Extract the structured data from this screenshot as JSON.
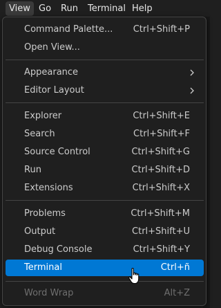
{
  "menubar": {
    "items": [
      "View",
      "Go",
      "Run",
      "Terminal",
      "Help"
    ]
  },
  "menu": {
    "command_palette": {
      "label": "Command Palette...",
      "shortcut": "Ctrl+Shift+P"
    },
    "open_view": {
      "label": "Open View..."
    },
    "appearance": {
      "label": "Appearance",
      "icon": "chevron-right-icon"
    },
    "editor_layout": {
      "label": "Editor Layout",
      "icon": "chevron-right-icon"
    },
    "explorer": {
      "label": "Explorer",
      "shortcut": "Ctrl+Shift+E"
    },
    "search": {
      "label": "Search",
      "shortcut": "Ctrl+Shift+F"
    },
    "source_control": {
      "label": "Source Control",
      "shortcut": "Ctrl+Shift+G"
    },
    "run": {
      "label": "Run",
      "shortcut": "Ctrl+Shift+D"
    },
    "extensions": {
      "label": "Extensions",
      "shortcut": "Ctrl+Shift+X"
    },
    "problems": {
      "label": "Problems",
      "shortcut": "Ctrl+Shift+M"
    },
    "output": {
      "label": "Output",
      "shortcut": "Ctrl+Shift+U"
    },
    "debug_console": {
      "label": "Debug Console",
      "shortcut": "Ctrl+Shift+Y"
    },
    "terminal": {
      "label": "Terminal",
      "shortcut": "Ctrl+ñ"
    },
    "word_wrap": {
      "label": "Word Wrap",
      "shortcut": "Alt+Z"
    }
  },
  "colors": {
    "background": "#1f1f1f",
    "highlight": "#0078d4",
    "separator": "#454545",
    "text": "#cccccc",
    "disabled_text": "#6f6f6f"
  },
  "cursor": {
    "icon": "hand-pointer-icon"
  }
}
